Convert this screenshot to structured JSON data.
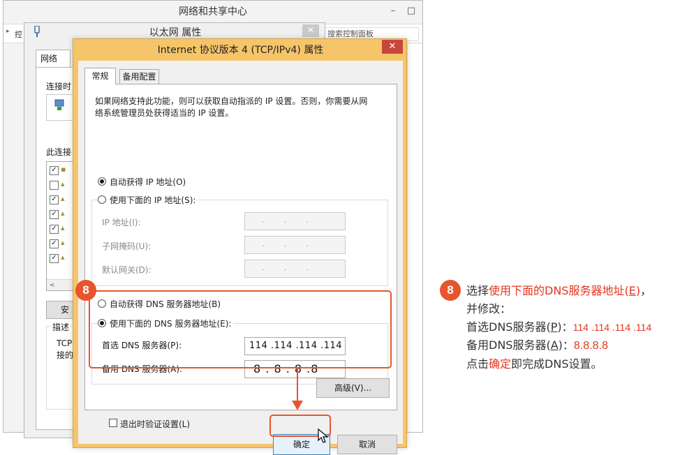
{
  "network_center": {
    "title": "网络和共享中心",
    "caption_buttons": [
      "–",
      "□"
    ],
    "breadcrumb": "控",
    "search_placeholder": "搜索控制面板",
    "back_glyph": "▸"
  },
  "ethernet_props": {
    "title": "以太网 属性",
    "close": "✕",
    "tab_network": "网络",
    "connect_label": "连接时",
    "uses_label": "此连接",
    "items_checked": [
      true,
      false,
      true,
      true,
      true,
      true,
      true
    ],
    "scroll_left": "<",
    "install_button": "安",
    "desc_title": "描述",
    "desc_lines": [
      "TCP",
      "接的"
    ]
  },
  "dialog": {
    "title": "Internet 协议版本 4 (TCP/IPv4) 属性",
    "close": "✕",
    "tabs": [
      "常规",
      "备用配置"
    ],
    "intro_line1": "如果网络支持此功能，则可以获取自动指派的 IP 设置。否则，你需要从网",
    "intro_line2": "络系统管理员处获得适当的 IP 设置。",
    "auto_ip_label": "自动获得 IP 地址(O)",
    "manual_ip_label": "使用下面的 IP 地址(S):",
    "ip_label": "IP 地址(I):",
    "mask_label": "子网掩码(U):",
    "gateway_label": "默认网关(D):",
    "empty_ip": "...",
    "auto_dns_label": "自动获得 DNS 服务器地址(B)",
    "manual_dns_label": "使用下面的 DNS 服务器地址(E):",
    "preferred_dns_label": "首选 DNS 服务器(P):",
    "preferred_dns_value": "114 .114 .114 .114",
    "alternate_dns_label": "备用 DNS 服务器(A):",
    "alternate_dns_value": "8  .  8  .  8  .8",
    "validate_label": "退出时验证设置(L)",
    "advanced_button": "高级(V)...",
    "ok_button": "确定",
    "cancel_button": "取消",
    "selected": {
      "auto_ip": true,
      "auto_dns": false,
      "manual_dns": true,
      "validate": false
    }
  },
  "annotation": {
    "step": "8",
    "accent_color": "#e8542e",
    "line1_a": "选择",
    "line1_red": "使用下面的DNS服务器地址(",
    "line1_key": "E",
    "line1_red_end": ")",
    "line1_b": "，",
    "line2": "并修改：",
    "line3_a": "首选DNS服务器(",
    "line3_key": "P",
    "line3_b": ")：",
    "line3_value": "114 .114 .114 .114",
    "line4_a": "备用DNS服务器(",
    "line4_key": "A",
    "line4_b": ")：",
    "line4_value": "8.8.8.8",
    "line5_a": "点击",
    "line5_red": "确定",
    "line5_b": "即完成DNS设置。"
  }
}
